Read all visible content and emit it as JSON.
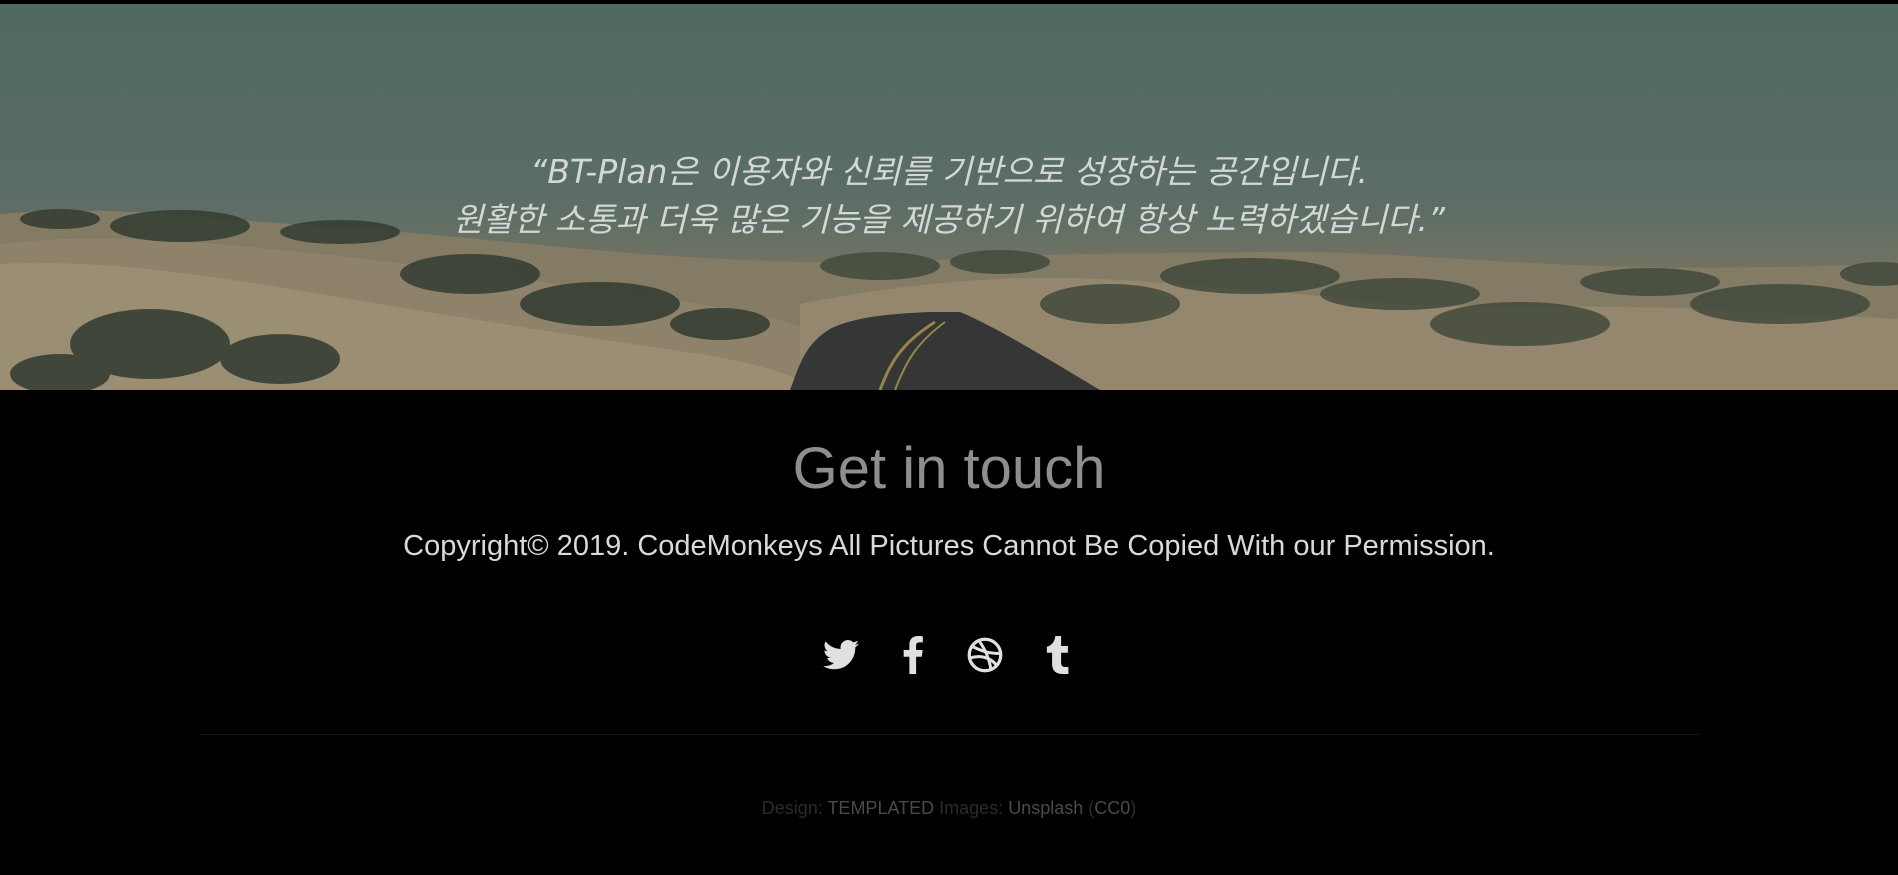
{
  "banner": {
    "quote_line1": "“BT-Plan은 이용자와 신뢰를 기반으로 성장하는 공간입니다.",
    "quote_line2": "원활한 소통과 더욱 많은 기능을 제공하기 위하여 항상 노력하겠습니다.”"
  },
  "contact": {
    "title": "Get in touch",
    "copyright": "Copyright© 2019. CodeMonkeys All Pictures Cannot Be Copied With our Permission.",
    "social": [
      {
        "icon": "twitter-icon"
      },
      {
        "icon": "facebook-icon"
      },
      {
        "icon": "dribbble-icon"
      },
      {
        "icon": "tumblr-icon"
      }
    ]
  },
  "credits": {
    "design_label": "Design:",
    "design_link": "TEMPLATED",
    "images_label": "Images:",
    "images_link": "Unsplash",
    "license_open": "(",
    "license_link": "CC0",
    "license_close": ")"
  },
  "colors": {
    "background": "#000000",
    "title": "#8e8e8e",
    "copyright": "#d9d9d9",
    "icons": "#e0e0e0"
  }
}
